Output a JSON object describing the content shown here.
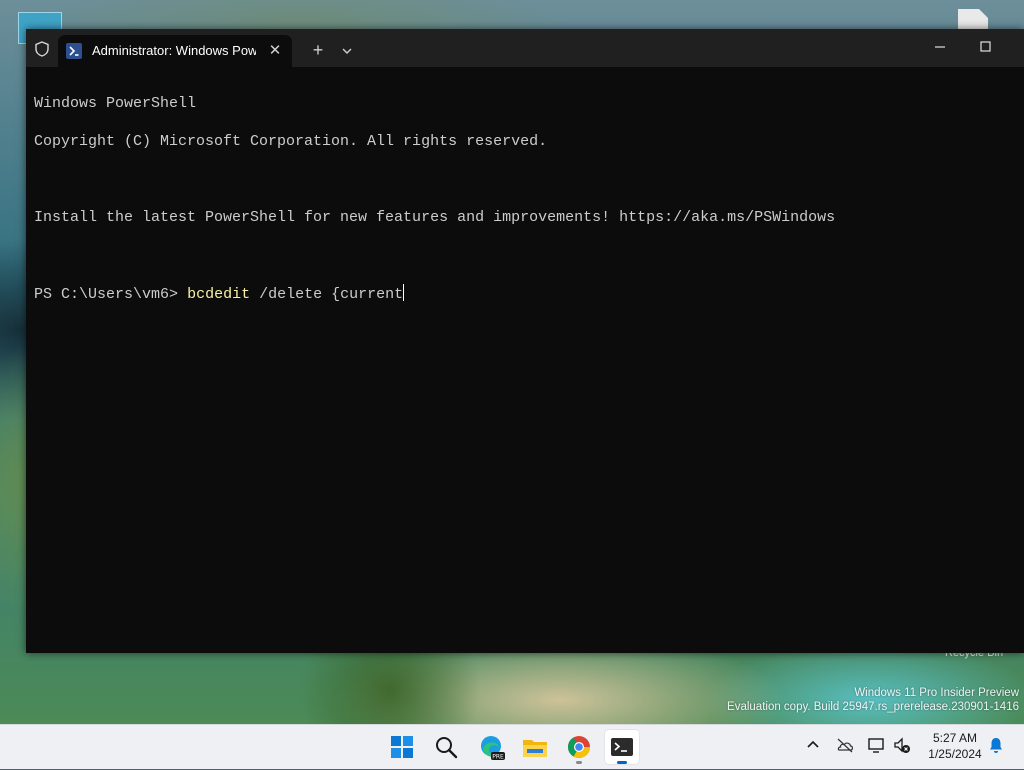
{
  "terminal": {
    "tab_title": "Administrator: Windows PowerShell",
    "new_tab_glyph": "+",
    "close_glyph": "✕",
    "icons": {
      "shield": "shield-icon",
      "powershell": "powershell-icon",
      "dropdown": "chevron-down-icon",
      "minimize": "minimize-icon",
      "maximize": "maximize-icon"
    },
    "lines": {
      "l1": "Windows PowerShell",
      "l2": "Copyright (C) Microsoft Corporation. All rights reserved.",
      "l3": "Install the latest PowerShell for new features and improvements! https://aka.ms/PSWindows"
    },
    "prompt": {
      "path": "PS C:\\Users\\vm6",
      "arrow": ">",
      "command": "bcdedit",
      "args": " /delete {current"
    },
    "colors": {
      "background": "#0c0c0c",
      "text": "#cccccc",
      "command": "#f9f1a5"
    }
  },
  "desktop": {
    "recycle_bin_label": "Recycle Bin",
    "watermark_line1": "Windows 11 Pro Insider Preview",
    "watermark_line2": "Evaluation copy. Build 25947.rs_prerelease.230901-1416"
  },
  "taskbar": {
    "apps": [
      "start-icon",
      "search-icon",
      "edge-icon",
      "file-explorer-icon",
      "chrome-icon",
      "terminal-icon"
    ],
    "edge_badge": "PRE",
    "tray": [
      "chevron-up-icon",
      "onedrive-icon",
      "display-icon",
      "volume-muted-icon",
      "notifications-icon"
    ],
    "time": "5:27 AM",
    "date": "1/25/2024"
  }
}
